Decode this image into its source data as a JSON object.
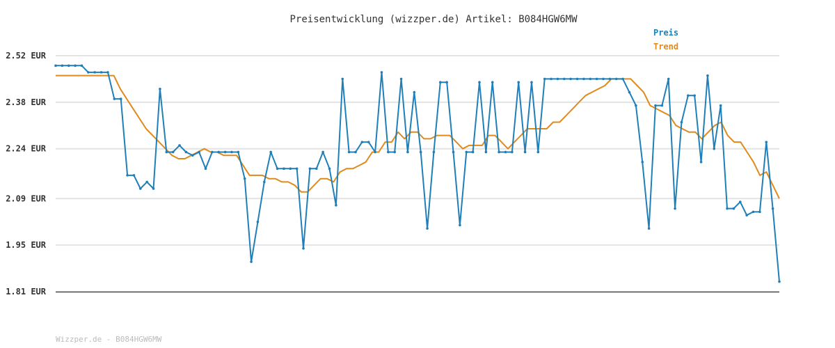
{
  "chart_data": {
    "type": "line",
    "title": "Preisentwicklung (wizzper.de) Artikel: B084HGW6MW",
    "xlabel": "",
    "ylabel": "",
    "ylim": [
      1.81,
      2.52
    ],
    "y_ticks": [
      "2.52 EUR",
      "2.38 EUR",
      "2.24 EUR",
      "2.09 EUR",
      "1.95 EUR",
      "1.81 EUR"
    ],
    "y_tick_values": [
      2.52,
      2.38,
      2.24,
      2.09,
      1.95,
      1.81
    ],
    "grid": true,
    "legend_position": "top-right",
    "series": [
      {
        "name": "Preis",
        "color": "#1f7fb8",
        "values": [
          2.49,
          2.49,
          2.49,
          2.49,
          2.49,
          2.47,
          2.47,
          2.47,
          2.47,
          2.39,
          2.39,
          2.16,
          2.16,
          2.12,
          2.14,
          2.12,
          2.42,
          2.23,
          2.23,
          2.25,
          2.23,
          2.22,
          2.23,
          2.18,
          2.23,
          2.23,
          2.23,
          2.23,
          2.23,
          2.15,
          1.9,
          2.02,
          2.14,
          2.23,
          2.18,
          2.18,
          2.18,
          2.18,
          1.94,
          2.18,
          2.18,
          2.23,
          2.18,
          2.07,
          2.45,
          2.23,
          2.23,
          2.26,
          2.26,
          2.23,
          2.47,
          2.23,
          2.23,
          2.45,
          2.23,
          2.41,
          2.23,
          2.0,
          2.23,
          2.44,
          2.44,
          2.23,
          2.01,
          2.23,
          2.23,
          2.44,
          2.23,
          2.44,
          2.23,
          2.23,
          2.23,
          2.44,
          2.23,
          2.44,
          2.23,
          2.45,
          2.45,
          2.45,
          2.45,
          2.45,
          2.45,
          2.45,
          2.45,
          2.45,
          2.45,
          2.45,
          2.45,
          2.45,
          2.41,
          2.37,
          2.2,
          2.0,
          2.37,
          2.37,
          2.45,
          2.06,
          2.32,
          2.4,
          2.4,
          2.2,
          2.46,
          2.24,
          2.37,
          2.06,
          2.06,
          2.08,
          2.04,
          2.05,
          2.05,
          2.26,
          2.06,
          1.84
        ]
      },
      {
        "name": "Trend",
        "color": "#e08a1e",
        "values": [
          2.46,
          2.46,
          2.46,
          2.46,
          2.46,
          2.46,
          2.46,
          2.46,
          2.46,
          2.46,
          2.42,
          2.39,
          2.36,
          2.33,
          2.3,
          2.28,
          2.26,
          2.24,
          2.22,
          2.21,
          2.21,
          2.22,
          2.23,
          2.24,
          2.23,
          2.23,
          2.22,
          2.22,
          2.22,
          2.19,
          2.16,
          2.16,
          2.16,
          2.15,
          2.15,
          2.14,
          2.14,
          2.13,
          2.11,
          2.11,
          2.13,
          2.15,
          2.15,
          2.14,
          2.17,
          2.18,
          2.18,
          2.19,
          2.2,
          2.23,
          2.23,
          2.26,
          2.26,
          2.29,
          2.27,
          2.29,
          2.29,
          2.27,
          2.27,
          2.28,
          2.28,
          2.28,
          2.26,
          2.24,
          2.25,
          2.25,
          2.25,
          2.28,
          2.28,
          2.26,
          2.24,
          2.26,
          2.28,
          2.3,
          2.3,
          2.3,
          2.3,
          2.32,
          2.32,
          2.34,
          2.36,
          2.38,
          2.4,
          2.41,
          2.42,
          2.43,
          2.45,
          2.45,
          2.45,
          2.45,
          2.43,
          2.41,
          2.37,
          2.36,
          2.35,
          2.34,
          2.31,
          2.3,
          2.29,
          2.29,
          2.27,
          2.29,
          2.31,
          2.32,
          2.28,
          2.26,
          2.26,
          2.23,
          2.2,
          2.16,
          2.17,
          2.13,
          2.09
        ]
      }
    ]
  },
  "footer": {
    "watermark": "Wizzper.de - B084HGW6MW"
  }
}
